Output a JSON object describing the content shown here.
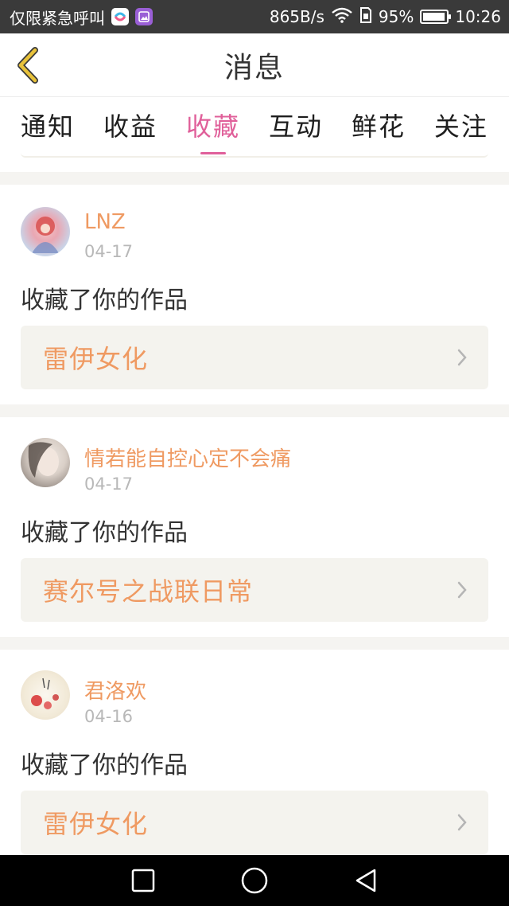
{
  "status_bar": {
    "carrier_text": "仅限紧急呼叫",
    "speed": "865B/s",
    "battery_percent": "95%",
    "battery_level": 0.95,
    "time": "10:26"
  },
  "header": {
    "title": "消息",
    "back_icon": "chevron-left-icon"
  },
  "tabs": [
    {
      "label": "通知",
      "active": false
    },
    {
      "label": "收益",
      "active": false
    },
    {
      "label": "收藏",
      "active": true
    },
    {
      "label": "互动",
      "active": false
    },
    {
      "label": "鲜花",
      "active": false
    },
    {
      "label": "关注",
      "active": false
    }
  ],
  "messages": [
    {
      "user": "LNZ",
      "date": "04-17",
      "action": "收藏了你的作品",
      "work": "雷伊女化"
    },
    {
      "user": "情若能自控心定不会痛",
      "date": "04-17",
      "action": "收藏了你的作品",
      "work": "赛尔号之战联日常"
    },
    {
      "user": "君洛欢",
      "date": "04-16",
      "action": "收藏了你的作品",
      "work": "雷伊女化"
    }
  ],
  "colors": {
    "accent_pink": "#e0609a",
    "name_orange": "#ef9a62",
    "back_yellow": "#e8c23a"
  },
  "nav_bar": {
    "icons": [
      "recent-apps-icon",
      "home-icon",
      "back-icon"
    ]
  }
}
